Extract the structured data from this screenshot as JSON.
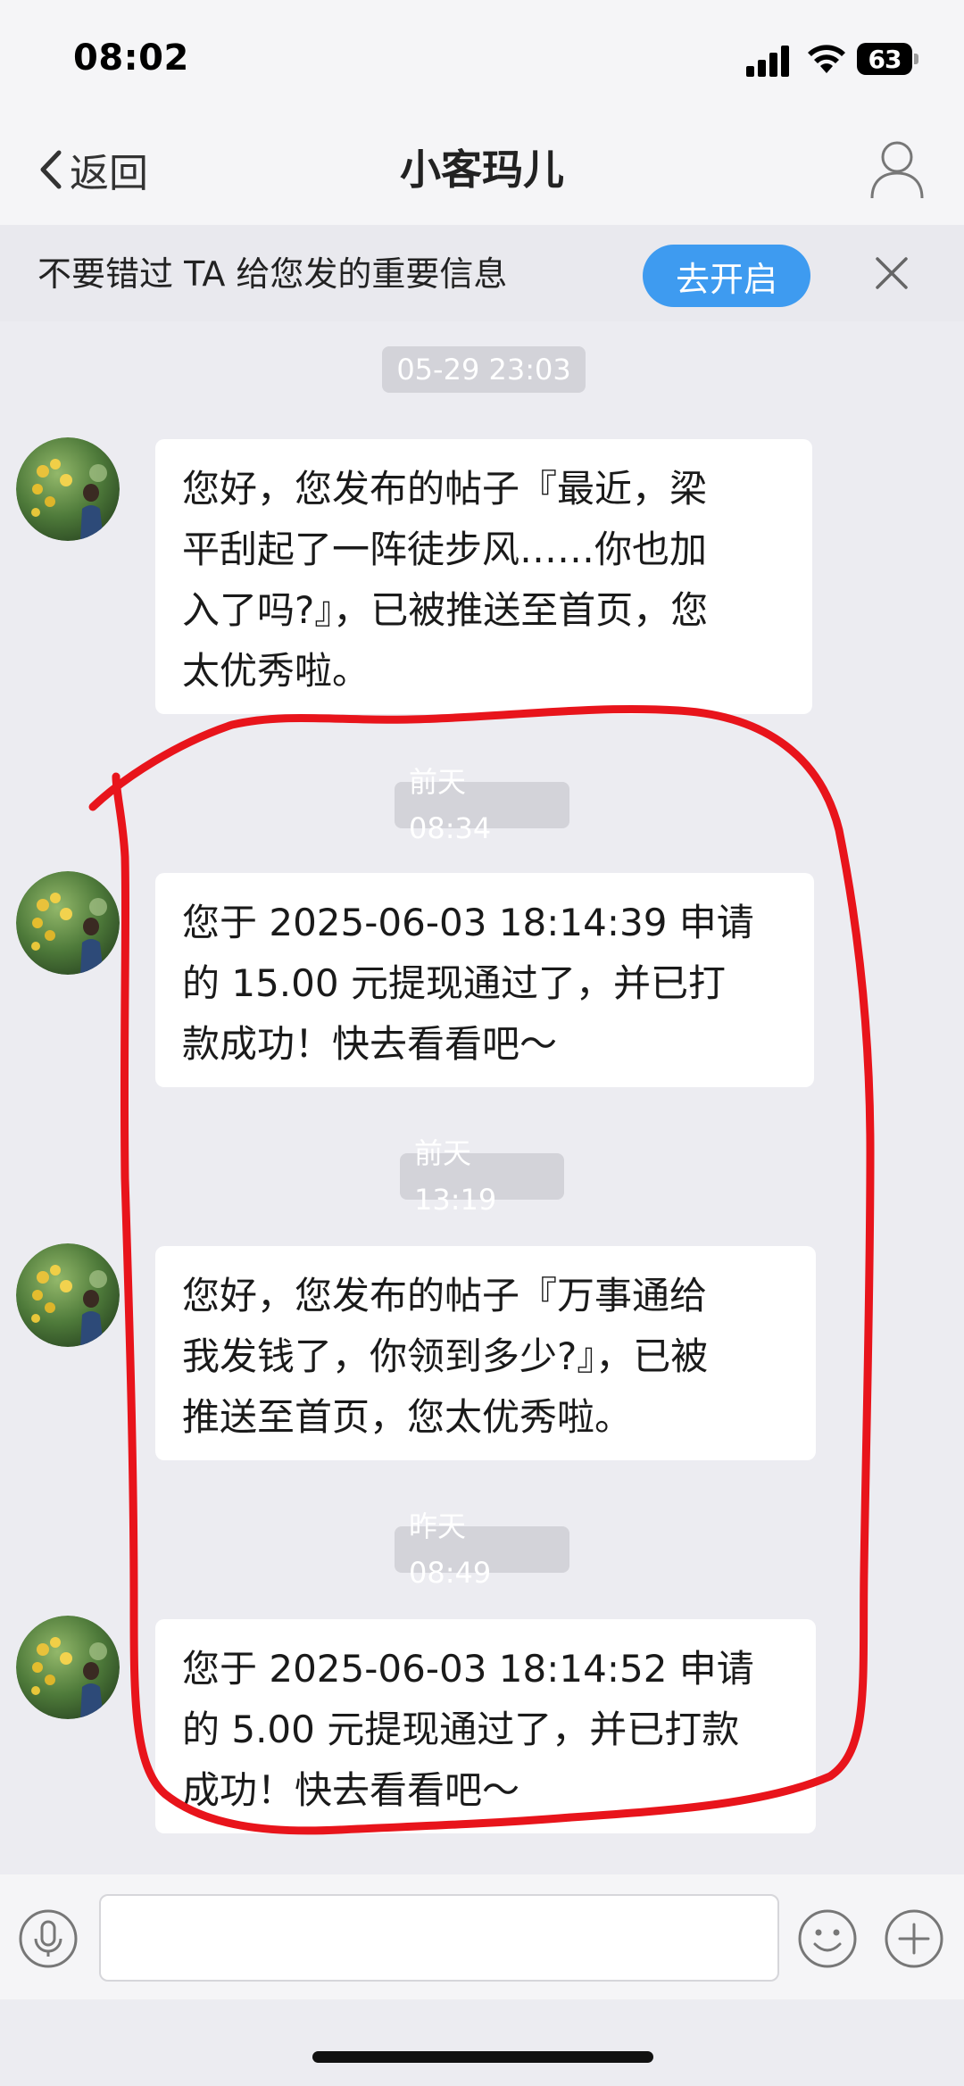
{
  "status_bar": {
    "time": "08:02",
    "battery": "63"
  },
  "nav": {
    "back_label": "返回",
    "title": "小客玛儿"
  },
  "notification": {
    "text": "不要错过 TA 给您发的重要信息",
    "button_label": "去开启"
  },
  "messages": [
    {
      "timestamp": "05-29 23:03",
      "lines": [
        "您好，您发布的帖子『最近，梁",
        "平刮起了一阵徒步风……你也加",
        "入了吗?』，已被推送至首页，您",
        "太优秀啦。"
      ]
    },
    {
      "timestamp": "前天 08:34",
      "lines": [
        "您于 2025-06-03 18:14:39 申请",
        "的 15.00 元提现通过了，并已打",
        "款成功！快去看看吧～"
      ]
    },
    {
      "timestamp": "前天 13:19",
      "lines": [
        "您好，您发布的帖子『万事通给",
        "我发钱了，你领到多少?』，已被",
        "推送至首页，您太优秀啦。"
      ]
    },
    {
      "timestamp": "昨天 08:49",
      "lines": [
        "您于 2025-06-03 18:14:52 申请",
        "的 5.00 元提现通过了，并已打款",
        "成功！快去看看吧～"
      ]
    }
  ],
  "colors": {
    "accent": "#3E9BF0",
    "annotation": "#E8141B",
    "background": "#ECECF1"
  },
  "icons": {
    "back": "chevron-left-icon",
    "profile": "user-icon",
    "close": "close-icon",
    "mic": "microphone-icon",
    "emoji": "emoji-icon",
    "plus": "plus-icon"
  }
}
